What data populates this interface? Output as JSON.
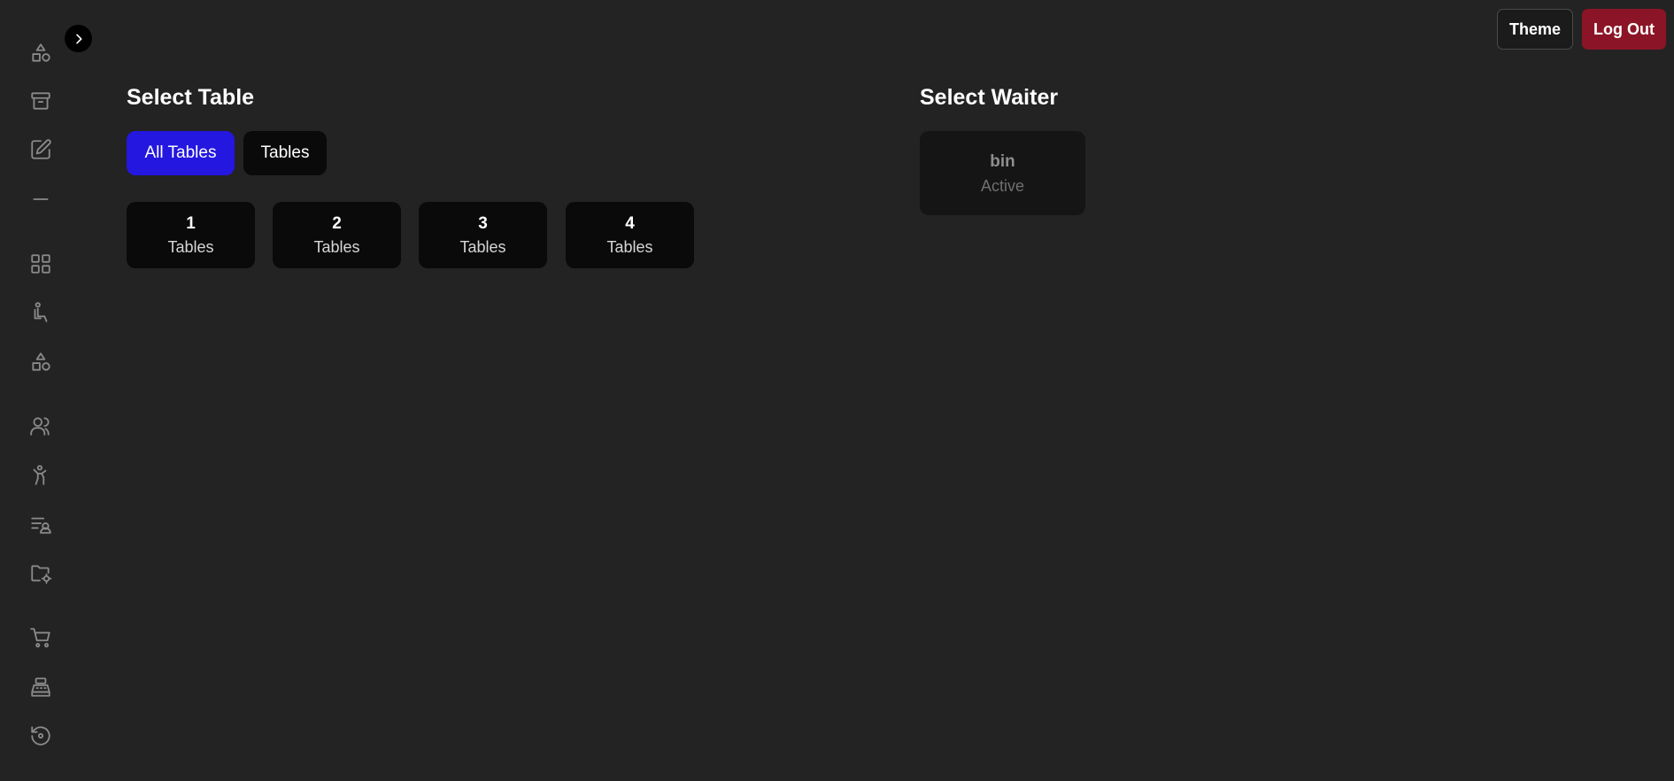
{
  "topbar": {
    "theme_label": "Theme",
    "logout_label": "Log Out"
  },
  "sidebar": {
    "icons": [
      "shapes-icon",
      "archive-icon",
      "edit-icon",
      "minus-icon",
      "grid-icon",
      "seat-icon",
      "shapes-icon",
      "users-icon",
      "person-icon",
      "list-user-icon",
      "folder-settings-icon",
      "cart-icon",
      "cash-register-icon",
      "history-icon"
    ]
  },
  "tables_section": {
    "title": "Select Table",
    "filters": [
      {
        "label": "All Tables",
        "active": true
      },
      {
        "label": "Tables",
        "active": false
      }
    ],
    "tables": [
      {
        "number": "1",
        "label": "Tables"
      },
      {
        "number": "2",
        "label": "Tables"
      },
      {
        "number": "3",
        "label": "Tables"
      },
      {
        "number": "4",
        "label": "Tables"
      }
    ]
  },
  "waiter_section": {
    "title": "Select Waiter",
    "waiters": [
      {
        "name": "bin",
        "status": "Active"
      }
    ]
  },
  "colors": {
    "background": "#232323",
    "active_filter": "#2417e0",
    "logout": "#8b1526",
    "card": "#0a0a0a"
  }
}
